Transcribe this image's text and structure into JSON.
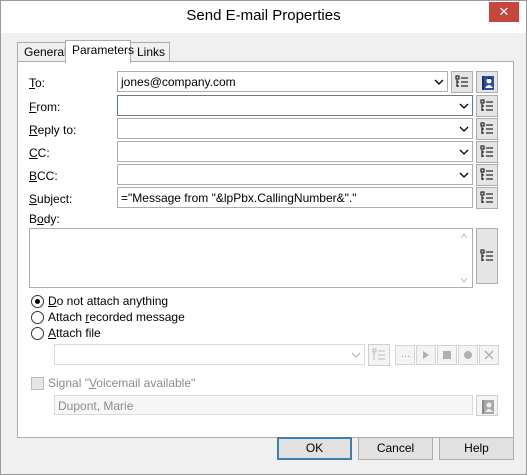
{
  "window": {
    "title": "Send E-mail Properties",
    "close_label": "✕"
  },
  "tabs": [
    {
      "label": "General"
    },
    {
      "label": "Parameters"
    },
    {
      "label": "Links"
    }
  ],
  "fields": {
    "to": {
      "label_u": "T",
      "label_rest": "o:",
      "value": "jones@company.com"
    },
    "from": {
      "label_u": "F",
      "label_rest": "rom:",
      "value": ""
    },
    "reply_to": {
      "label_u": "R",
      "label_rest": "eply to:",
      "value": ""
    },
    "cc": {
      "label_u": "C",
      "label_rest": "C:",
      "value": ""
    },
    "bcc": {
      "label_u": "B",
      "label_rest": "CC:",
      "value": ""
    },
    "subject": {
      "label_u": "S",
      "label_rest": "ubject:",
      "value": "=\"Message from \"&lpPbx.CallingNumber&\".\""
    },
    "body": {
      "label_pre": "B",
      "label_u": "o",
      "label_rest": "dy:",
      "value": ""
    }
  },
  "attachment": {
    "options": [
      {
        "u": "D",
        "rest": "o not attach anything",
        "checked": true
      },
      {
        "pre": "Attach ",
        "u": "r",
        "rest": "ecorded message",
        "checked": false
      },
      {
        "u": "A",
        "rest": "ttach file",
        "checked": false
      }
    ],
    "file_value": ""
  },
  "signal": {
    "label_pre": "Signal \"",
    "label_u": "V",
    "label_rest": "oicemail available\"",
    "user": "Dupont, Marie"
  },
  "buttons": {
    "ok": "OK",
    "cancel": "Cancel",
    "help": "Help",
    "browse": "..."
  }
}
